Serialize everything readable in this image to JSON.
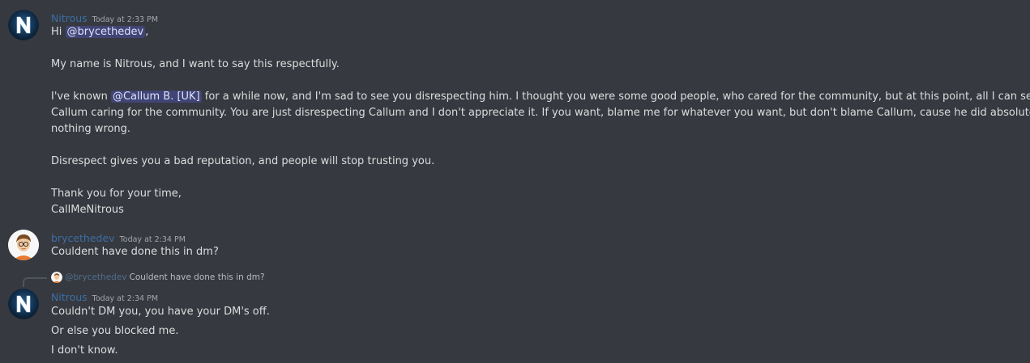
{
  "messages": [
    {
      "author": "Nitrous",
      "avatar": "nitrous-n-logo",
      "timestamp": "Today at 2:33 PM",
      "lines": {
        "hi_prefix": "Hi ",
        "hi_mention": "@brycethedev",
        "hi_suffix": ",",
        "intro": "My name is Nitrous, and I want to say this respectfully.",
        "p2_prefix": "I've known ",
        "p2_mention": "@Callum B. [UK]",
        "p2_line1_rest": " for a while now, and I'm sad to see you disrespecting him. I thought you were some good people, who cared for the community, but at this point, all I can see is",
        "p2_line2": "Callum caring for the community. You are just disrespecting Callum and I don't appreciate it. If you want, blame me for whatever you want, but don't blame Callum, cause he did absolutely",
        "p2_line3": "nothing wrong.",
        "p3": "Disrespect gives you a bad reputation, and people will stop trusting you.",
        "closing1": "Thank you for your time,",
        "closing2": "CallMeNitrous"
      }
    },
    {
      "author": "brycethedev",
      "avatar": "cartoon-person-avatar",
      "timestamp": "Today at 2:34 PM",
      "lines": {
        "text": "Couldent have done this in dm?"
      }
    },
    {
      "author": "Nitrous",
      "avatar": "nitrous-n-logo",
      "timestamp": "Today at 2:34 PM",
      "reply": {
        "user": "@brycethedev",
        "text": "Couldent have done this in dm?"
      },
      "lines": {
        "l1": "Couldn't DM you, you have your DM's off.",
        "l2": "Or else you blocked me.",
        "l3": "I don't know."
      }
    }
  ],
  "colors": {
    "background": "#36393f",
    "username": "#3b6fa6",
    "timestamp": "#a3a6aa",
    "text": "#dcddde",
    "mention_bg": "#4a4f8a",
    "mention_text": "#dee0fc"
  }
}
